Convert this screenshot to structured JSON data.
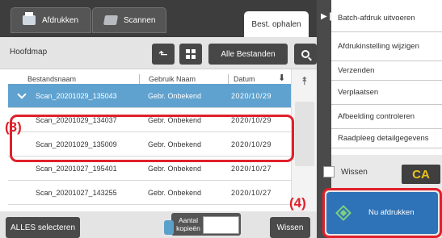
{
  "tabs": {
    "print": "Afdrukken",
    "scan": "Scannen",
    "retrieve": "Best. ophalen"
  },
  "toolbar": {
    "folder": "Hoofdmap",
    "all_files": "Alle Bestanden"
  },
  "columns": {
    "name": "Bestandsnaam",
    "user": "Gebruik Naam",
    "date": "Datum"
  },
  "files": [
    {
      "name": "Scan_20201029_135043",
      "user": "Gebr. Onbekend",
      "date": "2020/10/29",
      "selected": true
    },
    {
      "name": "Scan_20201029_134037",
      "user": "Gebr. Onbekend",
      "date": "2020/10/29",
      "selected": false
    },
    {
      "name": "Scan_20201029_135009",
      "user": "Gebr. Onbekend",
      "date": "2020/10/29",
      "selected": false
    },
    {
      "name": "Scan_20201027_195401",
      "user": "Gebr. Onbekend",
      "date": "2020/10/27",
      "selected": false
    },
    {
      "name": "Scan_20201027_143255",
      "user": "Gebr. Onbekend",
      "date": "2020/10/27",
      "selected": false
    }
  ],
  "bottom": {
    "select_all": "ALLES selecteren",
    "copies": "Aantal kopieën",
    "delete": "Wissen"
  },
  "menu": {
    "batch_print": "Batch-afdruk uitvoeren",
    "print_setting": "Afdrukinstelling wijzigen",
    "send": "Verzenden",
    "move": "Verplaatsen",
    "check_image": "Afbeelding controleren",
    "details": "Raadpleeg detailgegevens"
  },
  "right": {
    "clear_label": "Wissen",
    "ca": "CA",
    "print_now": "Nu afdrukken"
  },
  "annotations": {
    "step3": "(3)",
    "step4": "(4)"
  },
  "colors": {
    "selected_row": "#5fa2cf",
    "callout": "#e0202a",
    "start_button": "#2e73b8"
  }
}
